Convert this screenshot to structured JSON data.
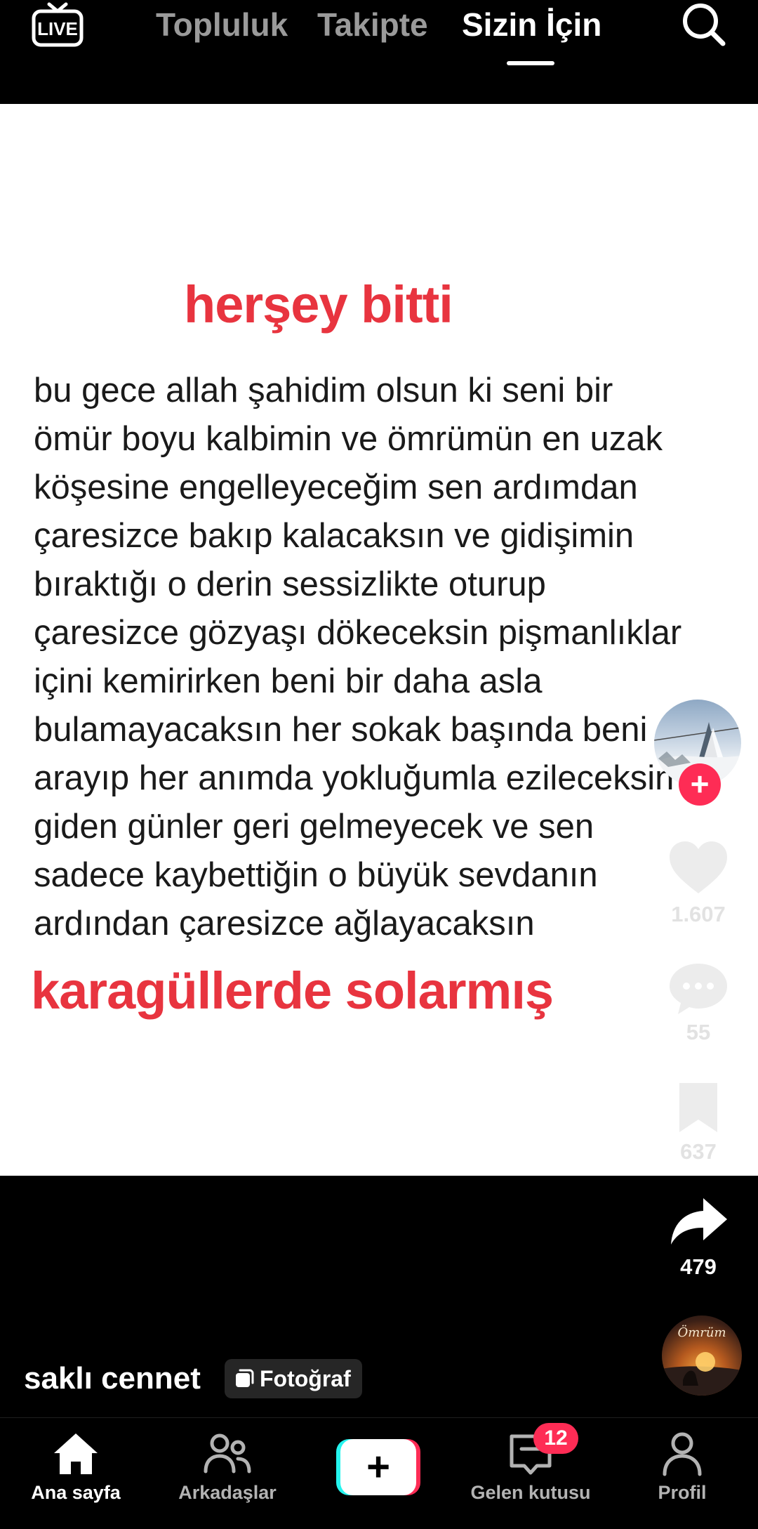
{
  "top_tabs": {
    "live_label": "LIVE",
    "items": [
      "Topluluk",
      "Takipte",
      "Sizin İçin"
    ],
    "active_index": 2
  },
  "post": {
    "title": "herşey bitti",
    "poem_lines": [
      "bu gece allah şahidim olsun ki seni bir",
      "ömür boyu kalbimin ve ömrümün en uzak",
      "köşesine engelleyeceğim sen ardımdan",
      "çaresizce bakıp kalacaksın ve gidişimin",
      "bıraktığı o derin sessizlikte oturup",
      "çaresizce gözyaşı dökeceksin pişmanlıklar",
      "içini kemirirken beni bir daha asla",
      "bulamayacaksın her sokak başında beni",
      "arayıp her anımda yokluğumla ezileceksin",
      "giden günler geri gelmeyecek ve sen",
      "sadece kaybettiğin o büyük sevdanın",
      "ardından çaresizce ağlayacaksın"
    ],
    "footer": "karagüllerde solarmış",
    "caption_author": "saklı cennet",
    "type_badge": "Fotoğraf",
    "music_disc_text": "Ömrüm"
  },
  "actions": {
    "likes": "1.607",
    "comments": "55",
    "saves": "637",
    "shares": "479",
    "follow_symbol": "+"
  },
  "bottom_nav": {
    "home": "Ana sayfa",
    "friends": "Arkadaşlar",
    "create_symbol": "+",
    "inbox": "Gelen kutusu",
    "inbox_badge": "12",
    "profile": "Profil"
  },
  "colors": {
    "accent_red": "#e8343f",
    "brand_pink": "#fe2c55",
    "brand_cyan": "#25f4ee"
  }
}
